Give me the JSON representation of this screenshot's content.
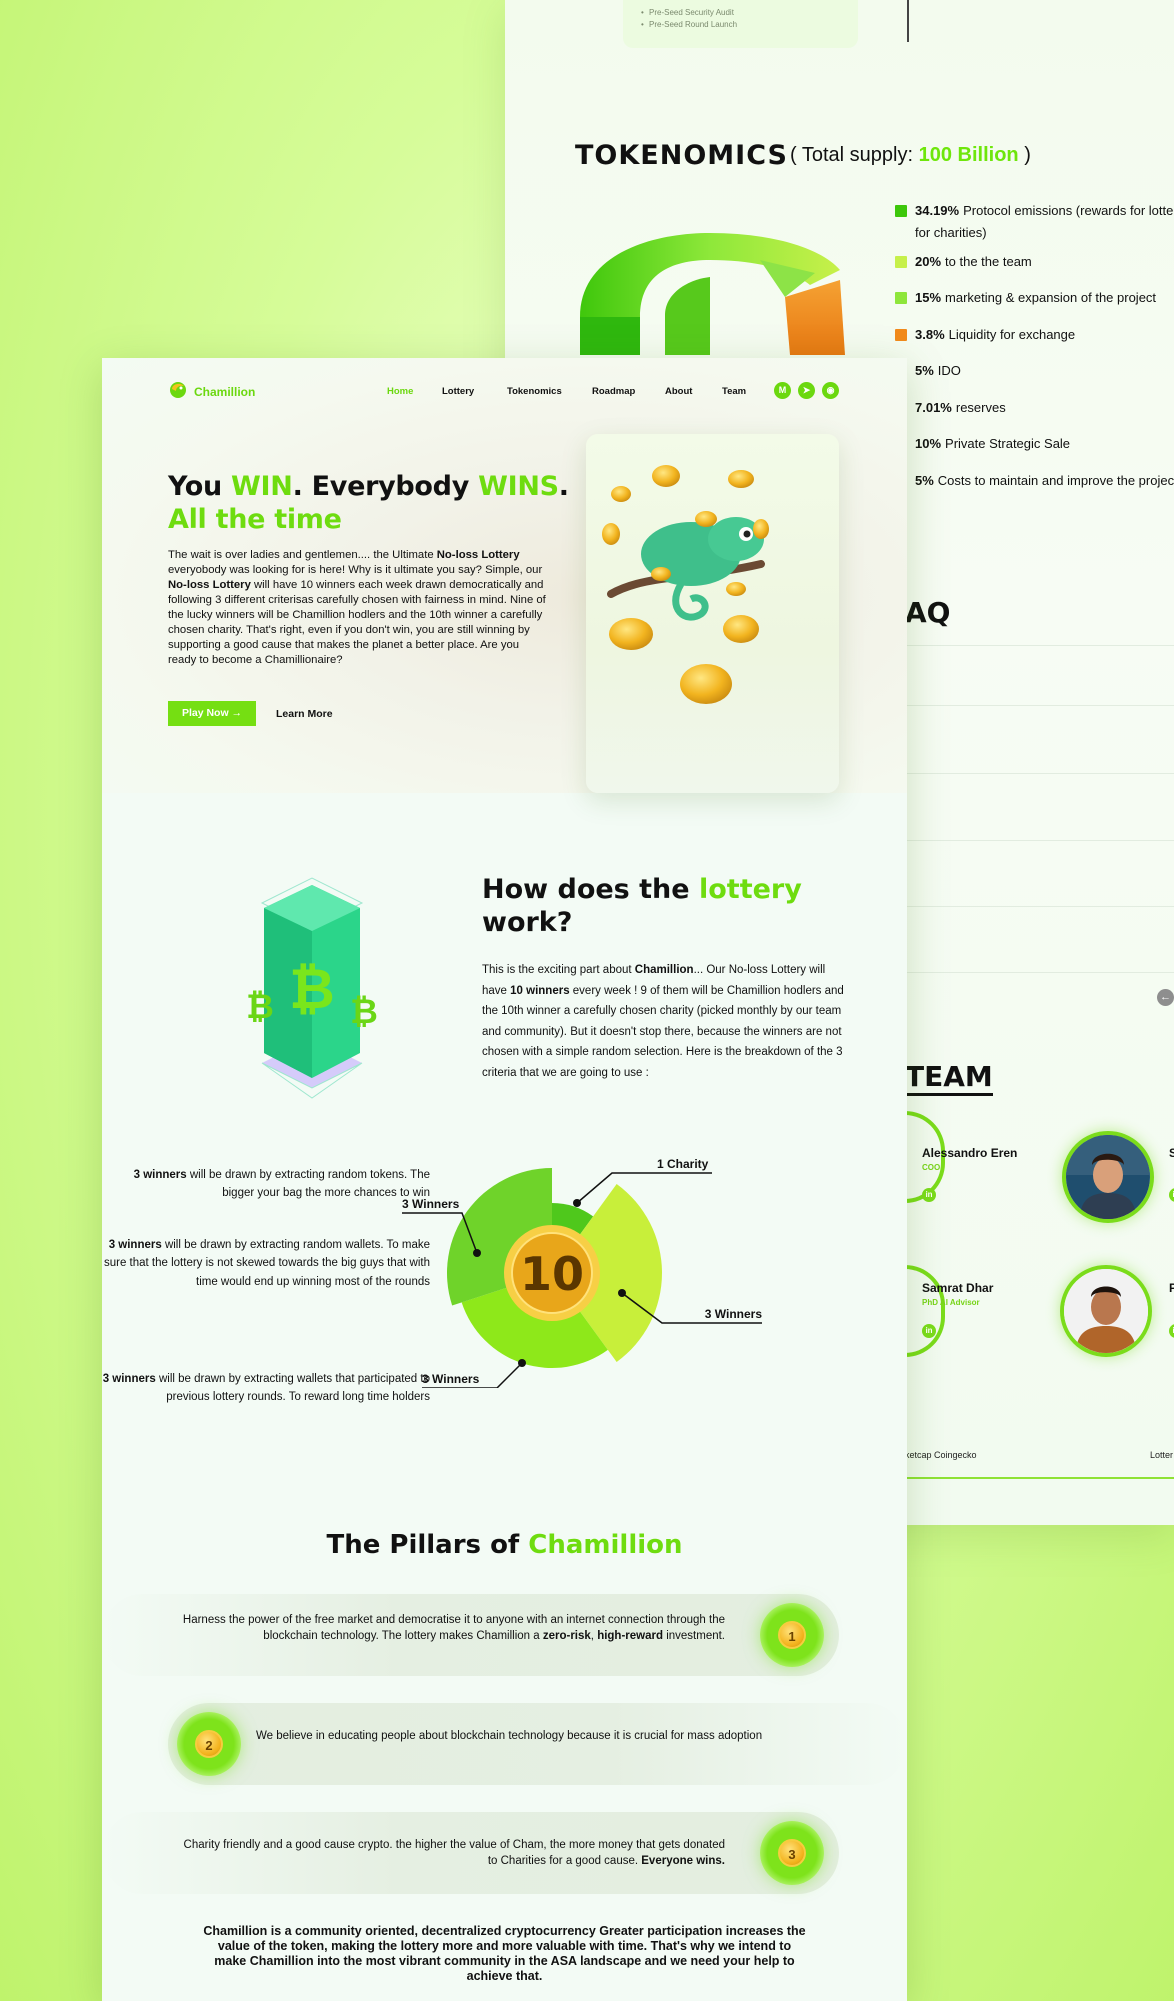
{
  "roadmap": {
    "items": [
      "Pre-Seed Security Audit",
      "Pre-Seed Round Launch"
    ]
  },
  "tokenomics": {
    "title": "TOKENOMICS",
    "supply_prefix": "( Total supply:",
    "supply_value": "100 Billion",
    "supply_suffix": ")",
    "items": [
      {
        "pct": "34.19%",
        "text": "Protocol emissions (rewards for lotter",
        "text2": "for charities)",
        "color": "#3cc70a"
      },
      {
        "pct": "20%",
        "text": "to the the team",
        "color": "#c6f04a"
      },
      {
        "pct": "15%",
        "text": "marketing & expansion of the project",
        "color": "#8ee63b"
      },
      {
        "pct": "3.8%",
        "text": "Liquidity for exchange",
        "color": "#f28a1b"
      },
      {
        "pct": "5%",
        "text": "IDO",
        "color": "#5fcf2a"
      },
      {
        "pct": "7.01%",
        "text": "reserves",
        "color": "#a7ea55"
      },
      {
        "pct": "10%",
        "text": "Private Strategic Sale",
        "color": "#2fb80e"
      },
      {
        "pct": "5%",
        "text": "Costs to maintain and improve the project",
        "color": "#7bd62a"
      }
    ]
  },
  "faq": {
    "title": "AQ"
  },
  "team": {
    "title": "TEAM",
    "members": [
      {
        "name": "Alessandro Eren",
        "role": "COO"
      },
      {
        "name": "Samrat Dhar",
        "role": "PhD AI Advisor"
      }
    ],
    "partial_s": "S",
    "partial_p": "P"
  },
  "back_footer": {
    "left": "ketcap   Coingecko",
    "right": "Lotter"
  },
  "nav": {
    "brand": "Chamillion",
    "links": [
      "Home",
      "Lottery",
      "Tokenomics",
      "Roadmap",
      "About",
      "Team"
    ]
  },
  "hero": {
    "title_1": "You ",
    "title_win": "WIN",
    "title_2": ". Everybody ",
    "title_wins": "WINS",
    "title_3": ".",
    "title_line2": "All the time",
    "body_html_parts": [
      "The wait is over ladies and gentlemen.... the Ultimate ",
      "No-loss Lottery",
      " everyobody was looking for is here! Why is it ultimate you say? Simple, our ",
      "No-loss Lottery",
      " will have 10 winners each week drawn democratically and following 3 different criterisas carefully chosen with fairness in mind. Nine of the lucky winners will be Chamillion hodlers and the 10th winner a carefully chosen charity. That's right, even if you don't win, you are still winning by supporting a good cause that makes the planet a better place. Are you ready to become a Chamillionaire?"
    ],
    "play_button": "Play Now →",
    "learn_more": "Learn More"
  },
  "how": {
    "title_1": "How does the ",
    "title_green": "lottery",
    "title_2": "work?",
    "text_parts": [
      "This is the exciting part about ",
      "Chamillion",
      "... Our No-loss Lottery will have ",
      "10 winners",
      " every week ! 9 of them will be Chamillion hodlers and the 10th winner a carefully chosen charity (picked monthly by our team and community). But it doesn't stop there, because the winners are not chosen with a simple random selection. Here is the breakdown of the 3 criteria that we are going to use :"
    ],
    "criteria": [
      {
        "bold": "3 winners",
        "text": " will be drawn by extracting random tokens. The bigger your bag the more chances to win"
      },
      {
        "bold": "3 winners",
        "text": " will be drawn by extracting random wallets. To make sure that the lottery is not skewed towards the big guys that with time  would end up winning most of the rounds"
      },
      {
        "bold": "3 winners",
        "text": " will be drawn by extracting wallets that participated to previous lottery rounds. To reward long time holders"
      }
    ]
  },
  "chart_data": {
    "type": "pie",
    "center_label": "10",
    "slices": [
      {
        "label": "1 Charity",
        "value": 1
      },
      {
        "label": "3 Winners",
        "value": 3
      },
      {
        "label": "3 Winners",
        "value": 3
      },
      {
        "label": "3 Winners",
        "value": 3
      }
    ],
    "colors": [
      "#4fc81c",
      "#c8ef3a",
      "#8ee81a",
      "#6fd32a"
    ]
  },
  "pillars": {
    "title_1": "The Pillars of ",
    "title_green": "Chamillion",
    "items": [
      {
        "num": "1",
        "parts": [
          "Harness the power of the free market and democratise it to anyone with an internet connection through the blockchain technology. The lottery makes Chamillion a ",
          "zero-risk",
          ", ",
          "high-reward",
          " investment."
        ]
      },
      {
        "num": "2",
        "parts": [
          "We believe in educating people about blockchain technology because it is crucial for mass adoption"
        ]
      },
      {
        "num": "3",
        "parts": [
          "Charity friendly and a good cause crypto.  the higher the value of Cham, the more money that gets donated to Charities for a  good cause. ",
          "Everyone wins."
        ]
      }
    ]
  },
  "closing": "Chamillion is a community oriented, decentralized cryptocurrency  Greater participation increases the value of the token, making the lottery more and more valuable with time. That's why we intend to  make Chamillion into the most vibrant community in the ASA landscape and we need your help to achieve that."
}
